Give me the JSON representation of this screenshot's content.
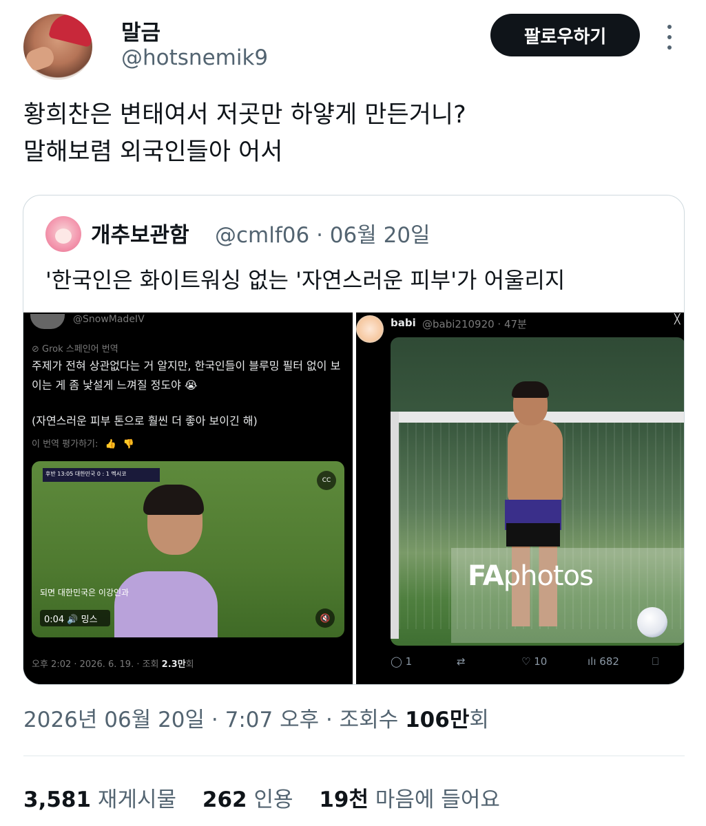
{
  "author": {
    "display_name": "말금",
    "handle": "@hotsnemik9",
    "follow_label": "팔로우하기"
  },
  "tweet": {
    "line1": "황희찬은 변태여서 저곳만 하얗게 만든거니?",
    "line2": "말해보렴 외국인들아 어서"
  },
  "quote": {
    "display_name": "개추보관함",
    "meta": "@cmlf06 · 06월 20일",
    "text": "'한국인은 화이트워싱 없는 '자연스러운 피부'가 어울리지",
    "left_panel": {
      "handle": "@SnowMadeIV",
      "grok_note": "Grok 스페인어 번역",
      "translation_1": "주제가 전혀 상관없다는 거 알지만, 한국인들이 블루밍 필터 없이 보이는 게 좀 낯설게 느껴질 정도야 😭",
      "translation_2": "(자연스러운 피부 톤으로 훨씬 더 좋아 보이긴 해)",
      "rate_label": "이 번역 평가하기:",
      "scorebar": "후반 13:05 대한민국 0 : 1 멕시코",
      "cc_label": "CC",
      "video_caption": "되면 대한민국은 이강인과",
      "timer": "0:04  🔊 밍스",
      "footer_prefix": "오후 2:02 · 2026. 6. 19. · 조회",
      "footer_views": "2.3만",
      "footer_suffix": "회"
    },
    "right_panel": {
      "name": "babi",
      "meta": "@babi210920 · 47분",
      "watermark_bold": "FA",
      "watermark_rest": "photos",
      "actions": {
        "replies": "1",
        "reposts": "",
        "likes": "10",
        "views": "682"
      }
    }
  },
  "timestamp": {
    "text": "2026년 06월 20일 · 7:07 오후 · 조회수 ",
    "views": "106만",
    "suffix": "회"
  },
  "stats": {
    "reposts_count": "3,581",
    "reposts_label": "재게시물",
    "quotes_count": "262",
    "quotes_label": "인용",
    "likes_count": "19천",
    "likes_label": "마음에 들어요"
  }
}
